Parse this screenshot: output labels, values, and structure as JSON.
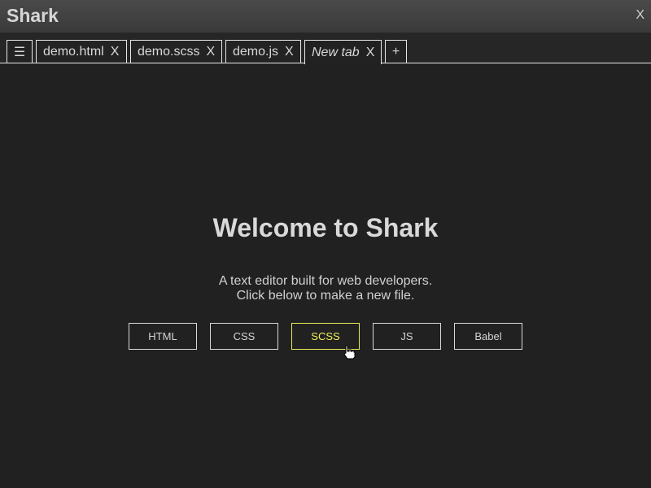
{
  "app": {
    "title": "Shark",
    "close_label": "X"
  },
  "tabbar": {
    "menu_icon": "☰",
    "tabs": [
      {
        "label": "demo.html",
        "close": "X",
        "active": false
      },
      {
        "label": "demo.scss",
        "close": "X",
        "active": false
      },
      {
        "label": "demo.js",
        "close": "X",
        "active": false
      },
      {
        "label": "New tab",
        "close": "X",
        "active": true
      }
    ],
    "add_label": "+"
  },
  "welcome": {
    "title": "Welcome to Shark",
    "line1": "A text editor built for web developers.",
    "line2": "Click below to make a new file."
  },
  "file_types": [
    {
      "label": "HTML"
    },
    {
      "label": "CSS"
    },
    {
      "label": "SCSS",
      "hovered": true
    },
    {
      "label": "JS"
    },
    {
      "label": "Babel"
    }
  ],
  "colors": {
    "background": "#212121",
    "hover_accent": "#f0f058"
  }
}
